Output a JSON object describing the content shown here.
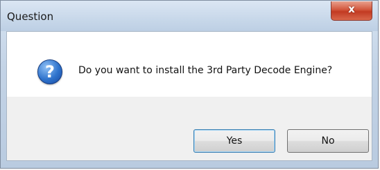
{
  "dialog": {
    "title": "Question",
    "close_label": "x",
    "icon": "question-icon",
    "message": "Do you want to install the 3rd Party Decode Engine?",
    "buttons": {
      "yes_label": "Yes",
      "no_label": "No"
    }
  }
}
